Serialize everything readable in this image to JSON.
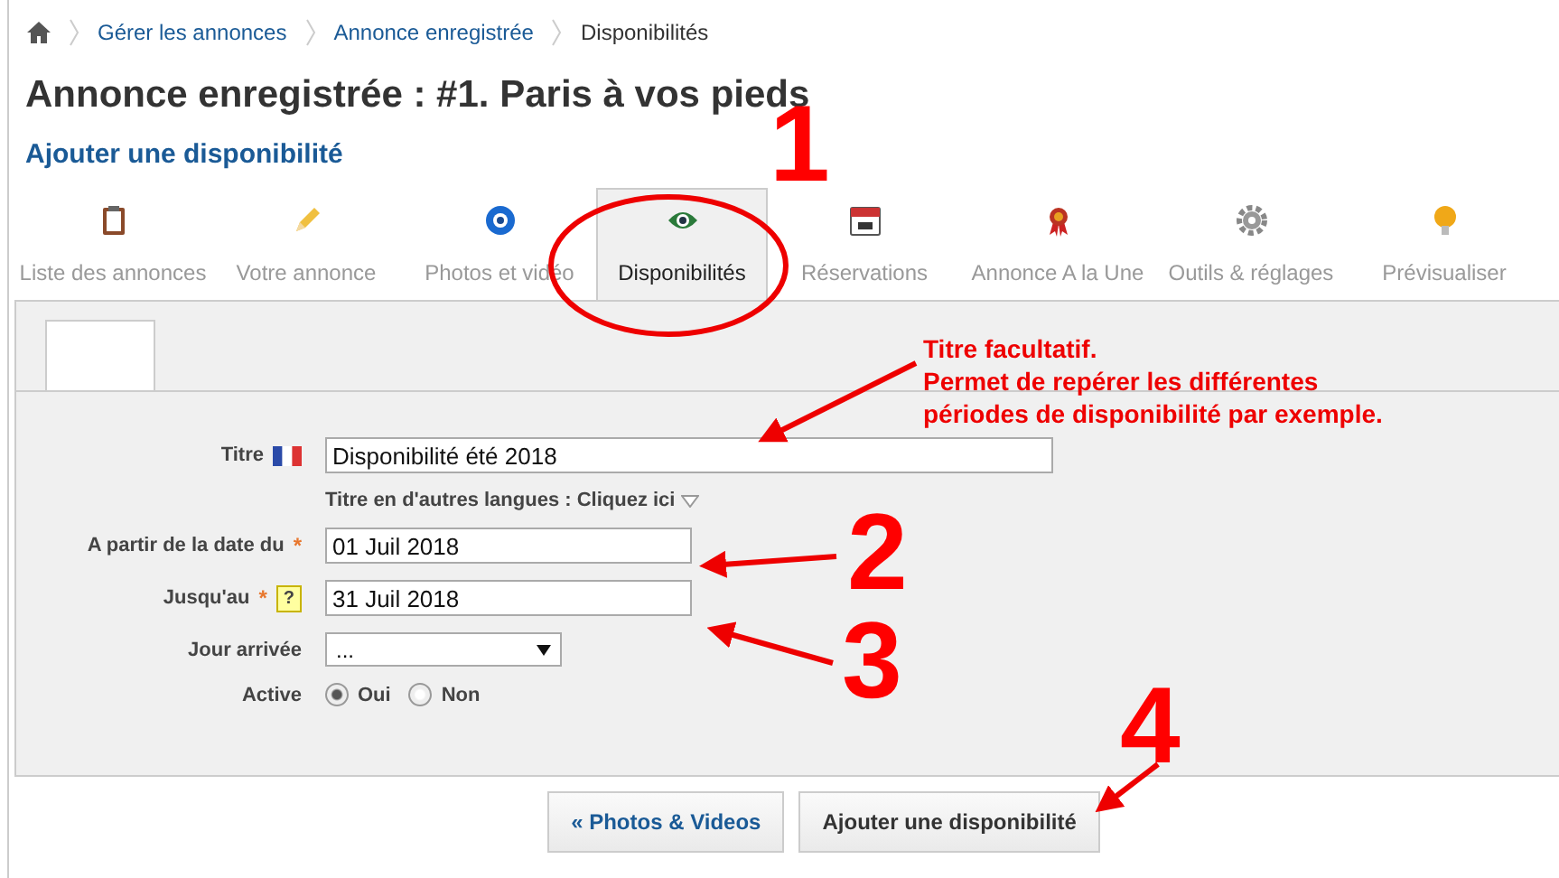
{
  "breadcrumb": [
    {
      "label": "Gérer les annonces",
      "kind": "link"
    },
    {
      "label": "Annonce enregistrée",
      "kind": "link"
    },
    {
      "label": "Disponibilités",
      "kind": "current"
    }
  ],
  "title": "Annonce enregistrée : #1. Paris à vos pieds",
  "subtitle": "Ajouter une disponibilité",
  "tabs": [
    {
      "label": "Liste des annonces",
      "selected": false
    },
    {
      "label": "Votre annonce",
      "selected": false
    },
    {
      "label": "Photos et vidéo",
      "selected": false
    },
    {
      "label": "Disponibilités",
      "selected": true
    },
    {
      "label": "Réservations",
      "selected": false
    },
    {
      "label": "Annonce A la Une",
      "selected": false
    },
    {
      "label": "Outils & réglages",
      "selected": false
    },
    {
      "label": "Prévisualiser",
      "selected": false
    }
  ],
  "form": {
    "fields": [
      {
        "kind": "text",
        "label": "Titre",
        "flag": true,
        "value": "Disponibilité été 2018"
      },
      {
        "kind": "note",
        "label": "Titre en d'autres langues : Cliquez ici"
      },
      {
        "kind": "text",
        "label": "A partir de la date du",
        "flag": false,
        "required_mark": "*",
        "value": "01 Juil 2018"
      },
      {
        "kind": "text",
        "label": "Jusqu'au",
        "flag": false,
        "required_mark": "*",
        "help_text": "?",
        "value": "31 Juil 2018"
      },
      {
        "kind": "select",
        "label": "Jour arrivée",
        "value": "..."
      },
      {
        "kind": "radio",
        "label": "Active",
        "options": [
          {
            "label": "Oui",
            "selected": true
          },
          {
            "label": "Non",
            "selected": false
          }
        ]
      }
    ]
  },
  "buttons": [
    {
      "label": "« Photos & Videos",
      "kind": "link"
    },
    {
      "label": "Ajouter une disponibilité",
      "kind": "primary"
    }
  ],
  "annotations": {
    "numbers": [
      "1",
      "2",
      "3",
      "4"
    ],
    "note": [
      "Titre facultatif.",
      "Permet de repérer les différentes",
      "périodes de disponibilité par exemple."
    ]
  }
}
